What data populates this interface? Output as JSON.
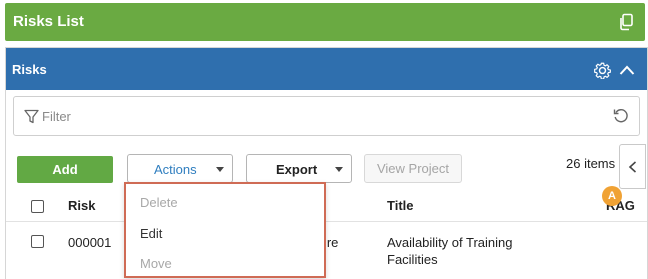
{
  "header": {
    "title": "Risks List",
    "copy_icon": "copy-icon"
  },
  "panel": {
    "title": "Risks",
    "settings_icon": "gear-icon",
    "collapse_icon": "chevron-up-icon"
  },
  "filter": {
    "placeholder": "Filter",
    "value": "",
    "filter_icon": "funnel-icon",
    "reset_icon": "reset-icon"
  },
  "toolbar": {
    "add_label": "Add",
    "actions_label": "Actions",
    "export_label": "Export",
    "view_project_label": "View Project",
    "items_count": "26 items"
  },
  "actions_menu": {
    "items": [
      {
        "label": "Delete",
        "enabled": false
      },
      {
        "label": "Edit",
        "enabled": true
      },
      {
        "label": "Move",
        "enabled": false
      }
    ]
  },
  "table": {
    "columns": [
      "Risk",
      "Title",
      "RAG"
    ],
    "rows": [
      {
        "risk": "000001",
        "hidden_fragment": "ture",
        "title_line1": "Availability of Training",
        "title_line2": "Facilities",
        "rag": "A"
      }
    ]
  },
  "colors": {
    "top_bar": "#6aaa42",
    "panel_header": "#2f6fae",
    "add_button": "#62a944",
    "rag_amber": "#f0a234",
    "menu_border": "#cf6b55"
  }
}
